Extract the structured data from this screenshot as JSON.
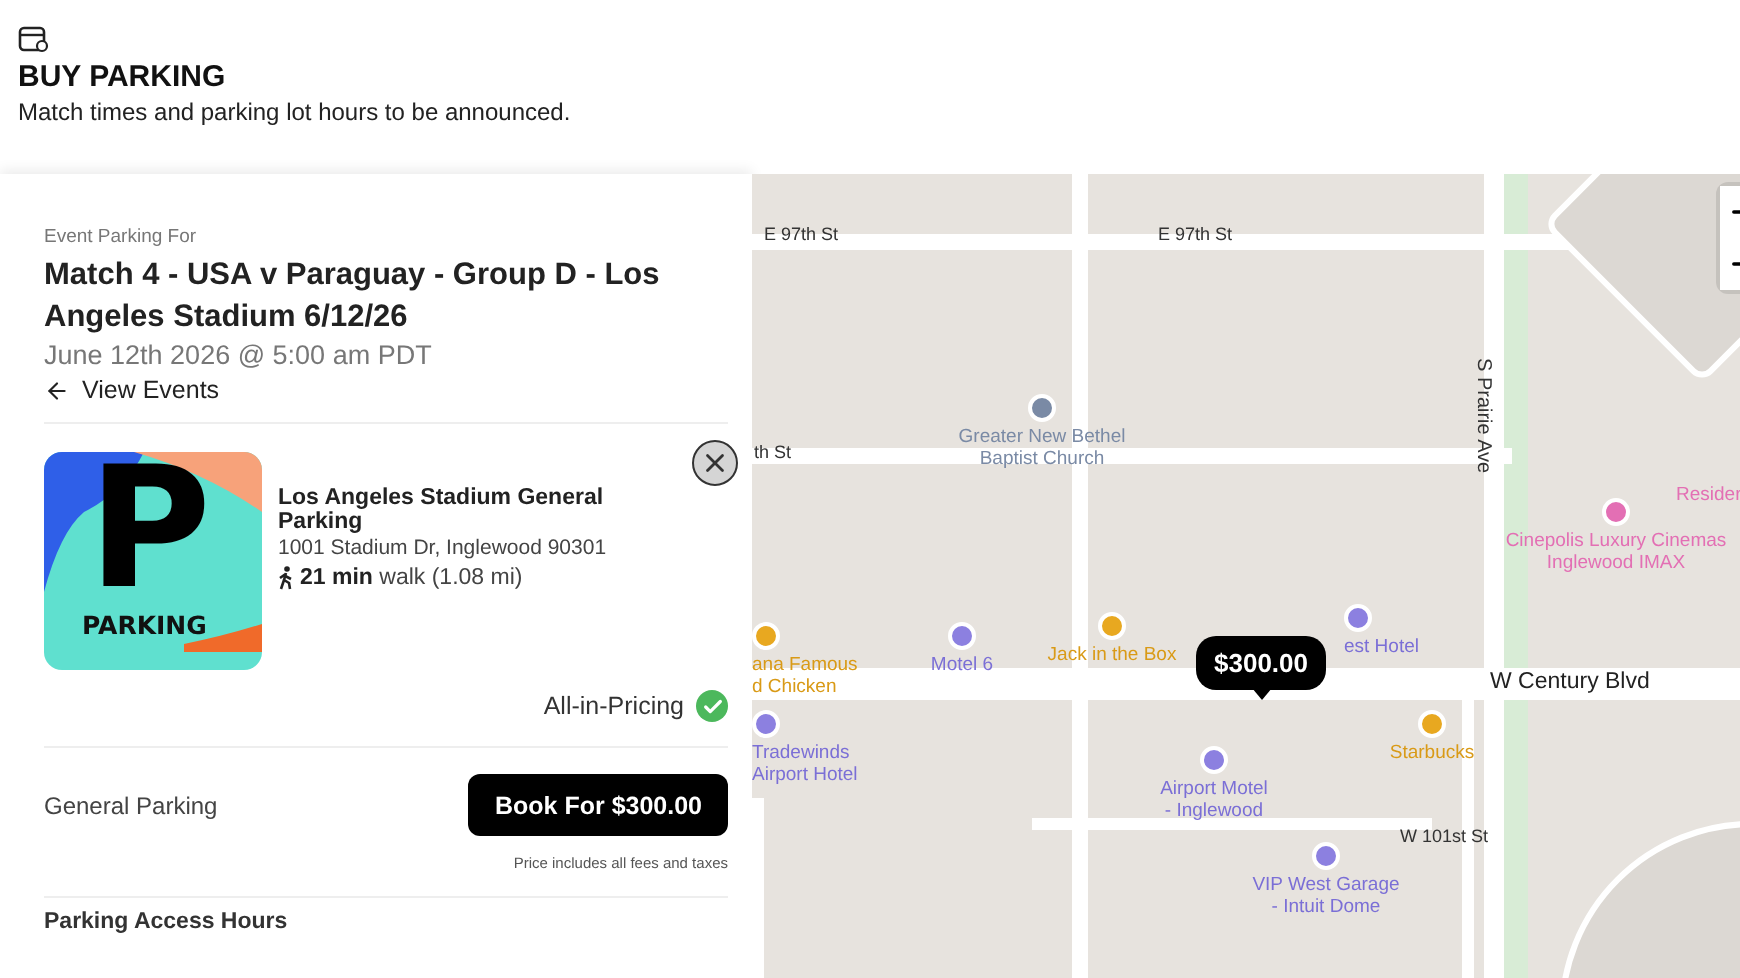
{
  "header": {
    "title": "BUY PARKING",
    "subtitle": "Match times and parking lot hours to be announced."
  },
  "event": {
    "eyebrow": "Event Parking For",
    "title": "Match 4 - USA v Paraguay - Group D - Los Angeles Stadium 6/12/26",
    "date": "June 12th 2026 @ 5:00 am PDT",
    "back_link": "View Events"
  },
  "lot": {
    "logo_letter": "P",
    "logo_wordmark": "PARKING",
    "name": "Los Angeles Stadium General Parking",
    "address": "1001 Stadium Dr, Inglewood 90301",
    "walk_time": "21 min",
    "walk_distance": "walk (1.08 mi)",
    "pricing_badge": "All-in-Pricing"
  },
  "offers": [
    {
      "name": "General Parking",
      "button": "Book For $300.00",
      "note": "Price includes all fees and taxes"
    }
  ],
  "next_section": "Parking Access Hours",
  "map": {
    "price_marker": "$300.00",
    "labels": [
      {
        "kind": "street",
        "lines": [
          "E 97th St"
        ]
      },
      {
        "kind": "street",
        "lines": [
          "E 97th St"
        ]
      },
      {
        "kind": "street",
        "lines": [
          "th St"
        ]
      },
      {
        "kind": "place",
        "lines": [
          "Greater New Bethel",
          "Baptist Church"
        ]
      },
      {
        "kind": "street-vertical",
        "lines": [
          "S Prairie Ave"
        ]
      },
      {
        "kind": "fragment",
        "lines": [
          "Resider"
        ]
      },
      {
        "kind": "entertainment",
        "lines": [
          "Cinepolis Luxury Cinemas",
          "Inglewood IMAX"
        ]
      },
      {
        "kind": "food",
        "lines": [
          "ana Famous",
          "d Chicken"
        ]
      },
      {
        "kind": "lodging",
        "lines": [
          "Motel 6"
        ]
      },
      {
        "kind": "food",
        "lines": [
          "Jack in the Box"
        ]
      },
      {
        "kind": "lodging",
        "lines": [
          "est Hotel"
        ]
      },
      {
        "kind": "major-street",
        "lines": [
          "W Century Blvd"
        ]
      },
      {
        "kind": "lodging",
        "lines": [
          "Tradewinds",
          "Airport Hotel"
        ]
      },
      {
        "kind": "lodging",
        "lines": [
          "Airport Motel",
          "- Inglewood"
        ]
      },
      {
        "kind": "food",
        "lines": [
          "Starbucks"
        ]
      },
      {
        "kind": "street",
        "lines": [
          "W 101st St"
        ]
      },
      {
        "kind": "lodging",
        "lines": [
          "VIP West Garage",
          "- Intuit Dome"
        ]
      }
    ]
  }
}
